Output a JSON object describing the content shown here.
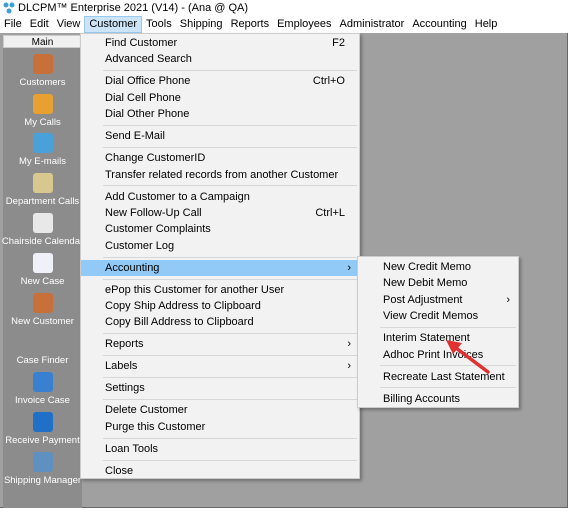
{
  "window": {
    "title": "DLCPM™ Enterprise 2021 (V14) - (Ana @ QA)"
  },
  "menubar": [
    "File",
    "Edit",
    "View",
    "Customer",
    "Tools",
    "Shipping",
    "Reports",
    "Employees",
    "Administrator",
    "Accounting",
    "Help"
  ],
  "sidebar": {
    "header": "Main",
    "items": [
      {
        "label": "Customers",
        "icon": "address-book-icon",
        "color": "#c8703a"
      },
      {
        "label": "My Calls",
        "icon": "pencil-icon",
        "color": "#e8a030"
      },
      {
        "label": "My E-mails",
        "icon": "email-icon",
        "color": "#4aa0d8"
      },
      {
        "label": "Department Calls",
        "icon": "clipboard-icon",
        "color": "#d8c890"
      },
      {
        "label": "Chairside Calendar",
        "icon": "calendar-icon",
        "color": "#e8e8e8"
      },
      {
        "label": "New Case",
        "icon": "new-case-icon",
        "color": "#f0f0f8"
      },
      {
        "label": "New Customer",
        "icon": "new-customer-icon",
        "color": "#c8703a"
      },
      {
        "label": "Case Finder",
        "icon": "glasses-icon",
        "color": "#8c8c8c"
      },
      {
        "label": "Invoice Case",
        "icon": "invoice-icon",
        "color": "#3a80d0"
      },
      {
        "label": "Receive Payment",
        "icon": "dollar-icon",
        "color": "#2070c8"
      },
      {
        "label": "Shipping Manager",
        "icon": "shipping-icon",
        "color": "#6090c0"
      }
    ]
  },
  "customer_menu": [
    {
      "label": "Find Customer",
      "shortcut": "F2"
    },
    {
      "label": "Advanced Search"
    },
    {
      "sep": true
    },
    {
      "label": "Dial Office Phone",
      "shortcut": "Ctrl+O"
    },
    {
      "label": "Dial Cell Phone"
    },
    {
      "label": "Dial Other Phone"
    },
    {
      "sep": true
    },
    {
      "label": "Send E-Mail"
    },
    {
      "sep": true
    },
    {
      "label": "Change CustomerID"
    },
    {
      "label": "Transfer related records from another Customer"
    },
    {
      "sep": true
    },
    {
      "label": "Add Customer to a Campaign"
    },
    {
      "label": "New Follow-Up Call",
      "shortcut": "Ctrl+L"
    },
    {
      "label": "Customer Complaints"
    },
    {
      "label": "Customer Log"
    },
    {
      "sep": true
    },
    {
      "label": "Accounting",
      "submenu": true,
      "highlighted": true
    },
    {
      "sep": true
    },
    {
      "label": "ePop this Customer for another User"
    },
    {
      "label": "Copy Ship Address to Clipboard"
    },
    {
      "label": "Copy Bill Address to Clipboard"
    },
    {
      "sep": true
    },
    {
      "label": "Reports",
      "submenu": true
    },
    {
      "sep": true
    },
    {
      "label": "Labels",
      "submenu": true
    },
    {
      "sep": true
    },
    {
      "label": "Settings"
    },
    {
      "sep": true
    },
    {
      "label": "Delete Customer"
    },
    {
      "label": "Purge this Customer"
    },
    {
      "sep": true
    },
    {
      "label": "Loan Tools"
    },
    {
      "sep": true
    },
    {
      "label": "Close"
    }
  ],
  "accounting_submenu": [
    {
      "label": "New Credit Memo"
    },
    {
      "label": "New Debit Memo"
    },
    {
      "label": "Post Adjustment",
      "submenu": true
    },
    {
      "label": "View Credit Memos"
    },
    {
      "sep": true
    },
    {
      "label": "Interim Statement"
    },
    {
      "label": "Adhoc Print Invoices"
    },
    {
      "sep": true
    },
    {
      "label": "Recreate Last Statement"
    },
    {
      "sep": true
    },
    {
      "label": "Billing Accounts"
    }
  ],
  "annotation": {
    "arrow_color": "#e03030",
    "points_to": "Interim Statement"
  }
}
